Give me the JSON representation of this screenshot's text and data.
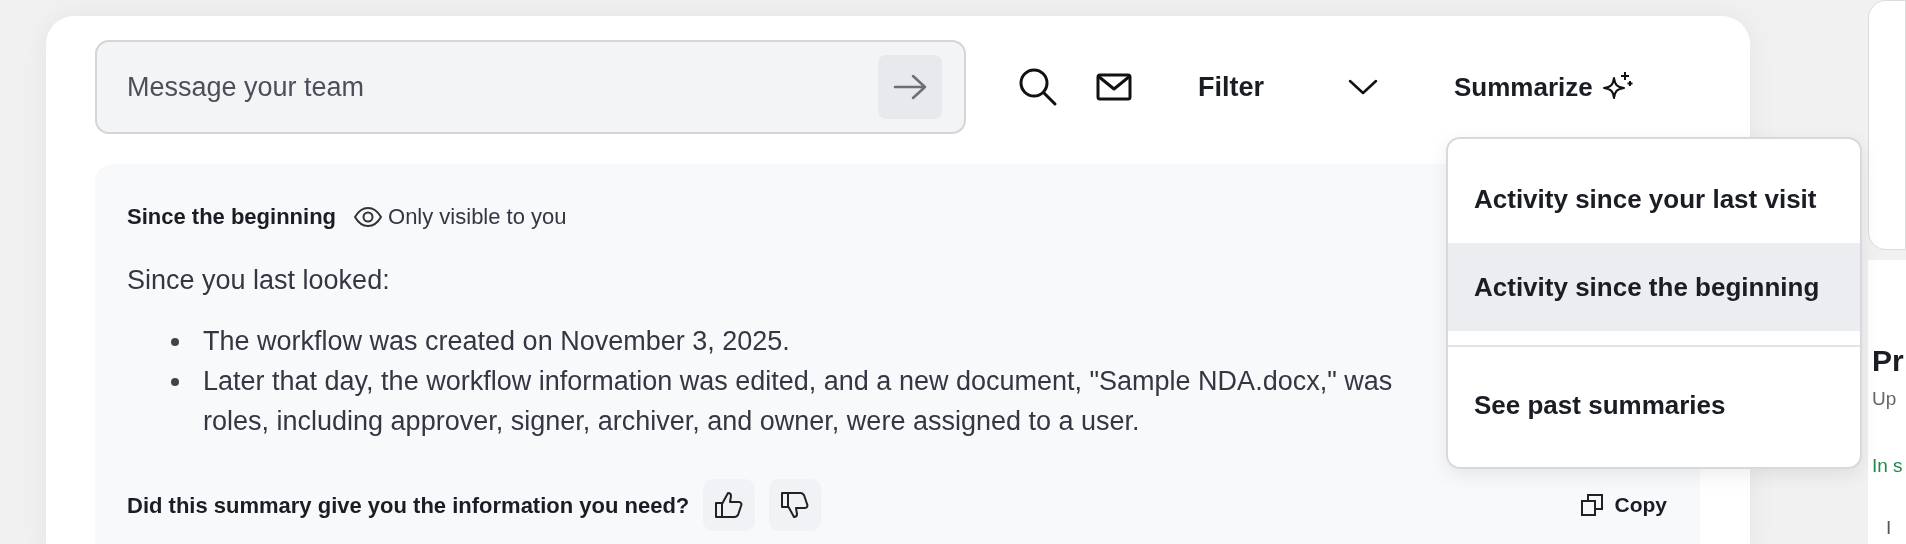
{
  "composer": {
    "placeholder": "Message your team"
  },
  "toolbar": {
    "filter_label": "Filter",
    "summarize_label": "Summarize"
  },
  "summary": {
    "title": "Since the beginning",
    "visibility": "Only visible to you",
    "intro": "Since you last looked:",
    "bullets": [
      {
        "lines": [
          "The workflow was created on November 3, 2025."
        ]
      },
      {
        "lines": [
          "Later that day, the workflow information was edited, and a new document, \"Sample NDA.docx,\" was",
          "roles, including approver, signer, archiver, and owner, were assigned to a user."
        ]
      }
    ],
    "feedback_question": "Did this summary give you the information you need?",
    "copy_label": "Copy"
  },
  "summarize_menu": {
    "items": [
      {
        "label": "Activity since your last visit",
        "selected": false
      },
      {
        "label": "Activity since the beginning",
        "selected": true
      },
      {
        "label": "See past summaries",
        "selected": false
      }
    ]
  },
  "side_panel": {
    "heading": "Pr",
    "subtitle": "Up",
    "status": "In s",
    "row": "I"
  }
}
